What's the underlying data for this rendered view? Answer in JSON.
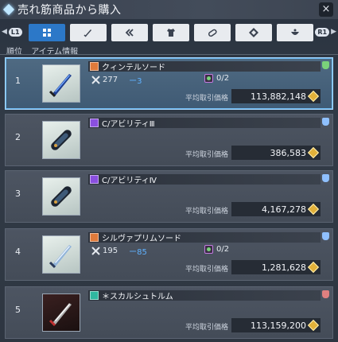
{
  "window": {
    "title": "売れ筋商品から購入",
    "close_label": "×"
  },
  "tabs": {
    "left_shoulder": "L1",
    "right_shoulder": "R1",
    "items": [
      {
        "name": "all",
        "icon": "grid-icon",
        "active": true
      },
      {
        "name": "sword",
        "icon": "sword-icon",
        "active": false
      },
      {
        "name": "ability",
        "icon": "double-chevron-icon",
        "active": false
      },
      {
        "name": "armor",
        "icon": "shirt-icon",
        "active": false
      },
      {
        "name": "capsule",
        "icon": "capsule-icon",
        "active": false
      },
      {
        "name": "material",
        "icon": "diamond-pattern-icon",
        "active": false
      },
      {
        "name": "consumable",
        "icon": "bowl-icon",
        "active": false
      }
    ]
  },
  "columns": {
    "rank": "順位",
    "item": "アイテム情報"
  },
  "price_label": "平均取引価格",
  "colors": {
    "accent": "#2c78c8",
    "ref_blue": "#5fb2ff",
    "coin": "#e2b13a"
  },
  "rows": [
    {
      "rank": "1",
      "name": "クィンテルソード",
      "category_color": "#e07a3a",
      "attack": "277",
      "refine": "ー3",
      "slots": "0/2",
      "price": "113,882,148",
      "badge_color": "#7ad27a",
      "thumb": "sword-blue-icon",
      "selected": true
    },
    {
      "rank": "2",
      "name": "C/アビリティⅢ",
      "category_color": "#8a4fe0",
      "attack": "",
      "refine": "",
      "slots": "",
      "price": "386,583",
      "badge_color": "#8fc0ff",
      "thumb": "capsule-icon",
      "selected": false
    },
    {
      "rank": "3",
      "name": "C/アビリティⅣ",
      "category_color": "#8a4fe0",
      "attack": "",
      "refine": "",
      "slots": "",
      "price": "4,167,278",
      "badge_color": "#8fc0ff",
      "thumb": "capsule-icon",
      "selected": false
    },
    {
      "rank": "4",
      "name": "シルヴァプリムソード",
      "category_color": "#e07a3a",
      "attack": "195",
      "refine": "ー85",
      "slots": "0/2",
      "price": "1,281,628",
      "badge_color": "#8fc0ff",
      "thumb": "sword-silver-icon",
      "selected": false
    },
    {
      "rank": "5",
      "name": "＊スカルシュトルム",
      "category_color": "#2fb7a0",
      "attack": "",
      "refine": "",
      "slots": "",
      "price": "113,159,200",
      "badge_color": "#e08080",
      "thumb": "sword-red-icon",
      "selected": false
    }
  ]
}
